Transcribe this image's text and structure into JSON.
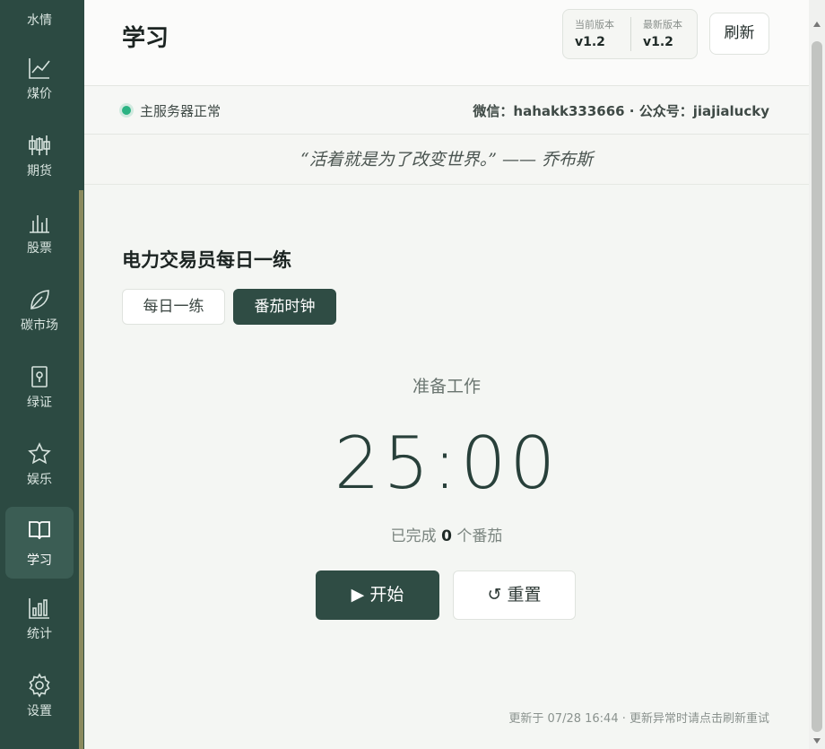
{
  "sidebar": {
    "top_partial_label": "水情",
    "items": [
      {
        "label": "煤价",
        "icon": "line-chart-icon"
      },
      {
        "label": "期货",
        "icon": "candlestick-icon"
      },
      {
        "label": "股票",
        "icon": "bar-chart-icon"
      },
      {
        "label": "碳市场",
        "icon": "leaf-icon"
      },
      {
        "label": "绿证",
        "icon": "certificate-icon"
      },
      {
        "label": "娱乐",
        "icon": "star-icon"
      },
      {
        "label": "学习",
        "icon": "book-icon",
        "active": true
      },
      {
        "label": "统计",
        "icon": "stats-icon"
      },
      {
        "label": "设置",
        "icon": "gear-icon"
      }
    ],
    "colors": {
      "background": "#2c4a42",
      "active": "#3b5d54"
    }
  },
  "header": {
    "title": "学习",
    "current_version_label": "当前版本",
    "current_version": "v1.2",
    "latest_version_label": "最新版本",
    "latest_version": "v1.2",
    "refresh_label": "刷新"
  },
  "status": {
    "server_text": "主服务器正常",
    "contact_text": "微信：hahakk333666 · 公众号：jiajialucky",
    "status_color": "#2bb383"
  },
  "quote": {
    "text": "“活着就是为了改变世界。” —— 乔布斯"
  },
  "main": {
    "section_title": "电力交易员每日一练",
    "tabs": [
      {
        "label": "每日一练",
        "active": false
      },
      {
        "label": "番茄时钟",
        "active": true
      }
    ],
    "timer_status": "准备工作",
    "timer_value": "25:00",
    "completed_prefix": "已完成",
    "completed_count": "0",
    "completed_suffix": "个番茄",
    "start_label": "▶ 开始",
    "reset_label": "↺ 重置"
  },
  "footer": {
    "text": "更新于 07/28 16:44 · 更新异常时请点击刷新重试"
  }
}
